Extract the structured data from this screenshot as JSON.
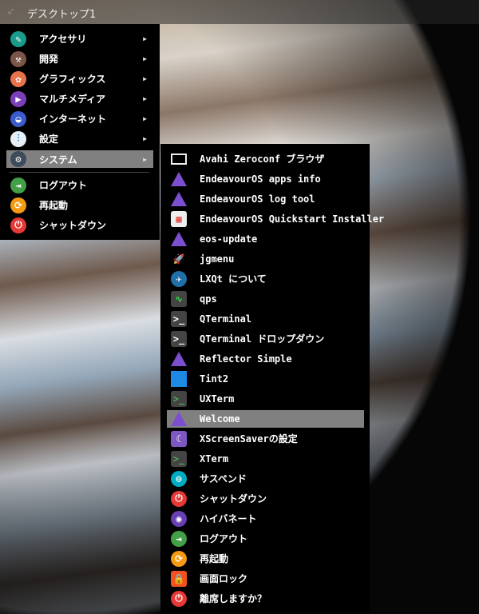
{
  "topbar": {
    "title": "デスクトップ1",
    "icon": "rocket-icon"
  },
  "main_menu": {
    "items": [
      {
        "label": "アクセサリ",
        "icon": "accessories-icon",
        "color": "#1a9c8c",
        "glyph": "✎",
        "submenu": true
      },
      {
        "label": "開発",
        "icon": "hammer-icon",
        "color": "#7a5548",
        "glyph": "⚒",
        "submenu": true
      },
      {
        "label": "グラフィックス",
        "icon": "graphics-icon",
        "color": "#e8734a",
        "glyph": "✿",
        "submenu": true
      },
      {
        "label": "マルチメディア",
        "icon": "multimedia-icon",
        "color": "#7b3fb8",
        "glyph": "▶",
        "submenu": true
      },
      {
        "label": "インターネット",
        "icon": "internet-icon",
        "color": "#3b5bcc",
        "glyph": "◒",
        "submenu": true
      },
      {
        "label": "設定",
        "icon": "settings-icon",
        "color": "#e8eef5",
        "glyph": "⫶",
        "submenu": true
      },
      {
        "label": "システム",
        "icon": "gear-icon",
        "color": "#3d4b5a",
        "glyph": "⚙",
        "submenu": true,
        "selected": true
      }
    ],
    "session": [
      {
        "label": "ログアウト",
        "icon": "logout-icon",
        "color": "#43a047",
        "glyph": "⇥"
      },
      {
        "label": "再起動",
        "icon": "restart-icon",
        "color": "#f59a12",
        "glyph": "⟳"
      },
      {
        "label": "シャットダウン",
        "icon": "power-icon",
        "color": "#e53935",
        "glyph": "⏻"
      }
    ]
  },
  "system_menu": {
    "items": [
      {
        "label": "Avahi Zeroconf ブラウザ",
        "icon": "network-port-icon",
        "color": "#000",
        "glyph": "⊓",
        "shape": "port"
      },
      {
        "label": "EndeavourOS apps info",
        "icon": "endeavouros-icon",
        "shape": "tri"
      },
      {
        "label": "EndeavourOS log tool",
        "icon": "endeavouros-icon",
        "shape": "tri"
      },
      {
        "label": "EndeavourOS Quickstart Installer",
        "icon": "installer-icon",
        "color": "#eeeeee",
        "glyph": "▦",
        "shape": "sq",
        "fg": "#e53935"
      },
      {
        "label": "eos-update",
        "icon": "endeavouros-icon",
        "shape": "tri"
      },
      {
        "label": "jgmenu",
        "icon": "rocket-icon",
        "color": "#000",
        "glyph": "🚀",
        "shape": "plain",
        "fg": "#777"
      },
      {
        "label": "LXQt について",
        "icon": "lxqt-icon",
        "color": "#1f6fa8",
        "glyph": "✈",
        "shape": "round"
      },
      {
        "label": "qps",
        "icon": "process-monitor-icon",
        "color": "#444",
        "glyph": "∿",
        "shape": "sq",
        "fg": "#2ee64b"
      },
      {
        "label": "QTerminal",
        "icon": "terminal-icon",
        "color": "#444",
        "glyph": ">_",
        "shape": "sq"
      },
      {
        "label": "QTerminal ドロップダウン",
        "icon": "terminal-icon",
        "color": "#444",
        "glyph": ">_",
        "shape": "sq"
      },
      {
        "label": "Reflector Simple",
        "icon": "endeavouros-icon",
        "shape": "tri"
      },
      {
        "label": "Tint2",
        "icon": "tint2-icon",
        "color": "#1e88e5",
        "glyph": "",
        "shape": "sq0"
      },
      {
        "label": "UXTerm",
        "icon": "terminal-icon",
        "color": "#444",
        "glyph": ">_",
        "shape": "sq",
        "fg": "#4caf50"
      },
      {
        "label": "Welcome",
        "icon": "endeavouros-icon",
        "shape": "tri",
        "selected": true
      },
      {
        "label": "XScreenSaverの設定",
        "icon": "screensaver-icon",
        "color": "#7e57c2",
        "glyph": "☾",
        "shape": "sq"
      },
      {
        "label": "XTerm",
        "icon": "terminal-icon",
        "color": "#444",
        "glyph": ">_",
        "shape": "sq",
        "fg": "#4caf50"
      },
      {
        "label": "サスペンド",
        "icon": "suspend-icon",
        "color": "#00acc1",
        "glyph": "⊖",
        "shape": "round"
      },
      {
        "label": "シャットダウン",
        "icon": "power-icon",
        "color": "#e53935",
        "glyph": "⏻",
        "shape": "round"
      },
      {
        "label": "ハイバネート",
        "icon": "hibernate-icon",
        "color": "#6a3fb5",
        "glyph": "◉",
        "shape": "round"
      },
      {
        "label": "ログアウト",
        "icon": "logout-icon",
        "color": "#43a047",
        "glyph": "⇥",
        "shape": "round"
      },
      {
        "label": "再起動",
        "icon": "restart-icon",
        "color": "#f59a12",
        "glyph": "⟳",
        "shape": "round"
      },
      {
        "label": "画面ロック",
        "icon": "lock-icon",
        "color": "#f4511e",
        "glyph": "🔒",
        "shape": "sq"
      },
      {
        "label": "離席しますか？",
        "icon": "power-icon",
        "color": "#e53935",
        "glyph": "⏻",
        "shape": "round"
      }
    ]
  },
  "arrow_glyph": "▶"
}
